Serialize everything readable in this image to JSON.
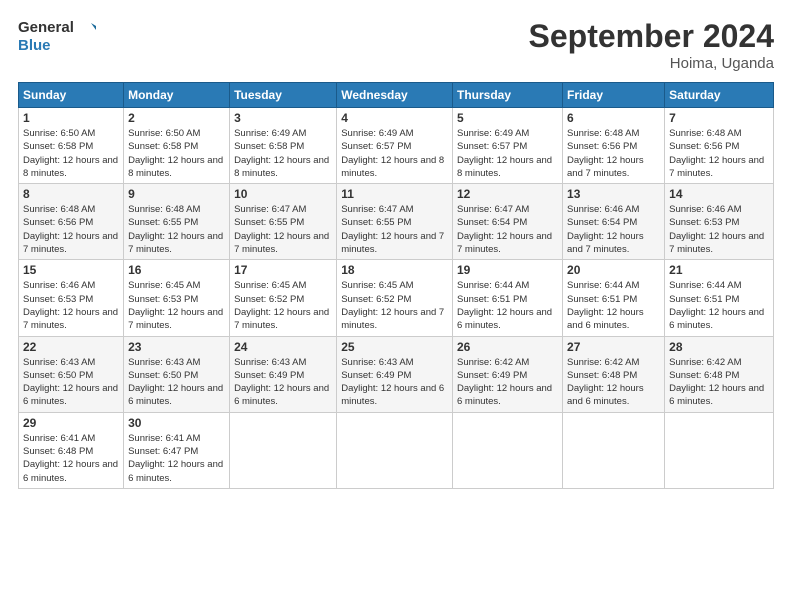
{
  "logo": {
    "line1": "General",
    "line2": "Blue"
  },
  "title": "September 2024",
  "subtitle": "Hoima, Uganda",
  "days_header": [
    "Sunday",
    "Monday",
    "Tuesday",
    "Wednesday",
    "Thursday",
    "Friday",
    "Saturday"
  ],
  "weeks": [
    [
      {
        "day": "1",
        "sunrise": "6:50 AM",
        "sunset": "6:58 PM",
        "daylight": "12 hours and 8 minutes."
      },
      {
        "day": "2",
        "sunrise": "6:50 AM",
        "sunset": "6:58 PM",
        "daylight": "12 hours and 8 minutes."
      },
      {
        "day": "3",
        "sunrise": "6:49 AM",
        "sunset": "6:58 PM",
        "daylight": "12 hours and 8 minutes."
      },
      {
        "day": "4",
        "sunrise": "6:49 AM",
        "sunset": "6:57 PM",
        "daylight": "12 hours and 8 minutes."
      },
      {
        "day": "5",
        "sunrise": "6:49 AM",
        "sunset": "6:57 PM",
        "daylight": "12 hours and 8 minutes."
      },
      {
        "day": "6",
        "sunrise": "6:48 AM",
        "sunset": "6:56 PM",
        "daylight": "12 hours and 7 minutes."
      },
      {
        "day": "7",
        "sunrise": "6:48 AM",
        "sunset": "6:56 PM",
        "daylight": "12 hours and 7 minutes."
      }
    ],
    [
      {
        "day": "8",
        "sunrise": "6:48 AM",
        "sunset": "6:56 PM",
        "daylight": "12 hours and 7 minutes."
      },
      {
        "day": "9",
        "sunrise": "6:48 AM",
        "sunset": "6:55 PM",
        "daylight": "12 hours and 7 minutes."
      },
      {
        "day": "10",
        "sunrise": "6:47 AM",
        "sunset": "6:55 PM",
        "daylight": "12 hours and 7 minutes."
      },
      {
        "day": "11",
        "sunrise": "6:47 AM",
        "sunset": "6:55 PM",
        "daylight": "12 hours and 7 minutes."
      },
      {
        "day": "12",
        "sunrise": "6:47 AM",
        "sunset": "6:54 PM",
        "daylight": "12 hours and 7 minutes."
      },
      {
        "day": "13",
        "sunrise": "6:46 AM",
        "sunset": "6:54 PM",
        "daylight": "12 hours and 7 minutes."
      },
      {
        "day": "14",
        "sunrise": "6:46 AM",
        "sunset": "6:53 PM",
        "daylight": "12 hours and 7 minutes."
      }
    ],
    [
      {
        "day": "15",
        "sunrise": "6:46 AM",
        "sunset": "6:53 PM",
        "daylight": "12 hours and 7 minutes."
      },
      {
        "day": "16",
        "sunrise": "6:45 AM",
        "sunset": "6:53 PM",
        "daylight": "12 hours and 7 minutes."
      },
      {
        "day": "17",
        "sunrise": "6:45 AM",
        "sunset": "6:52 PM",
        "daylight": "12 hours and 7 minutes."
      },
      {
        "day": "18",
        "sunrise": "6:45 AM",
        "sunset": "6:52 PM",
        "daylight": "12 hours and 7 minutes."
      },
      {
        "day": "19",
        "sunrise": "6:44 AM",
        "sunset": "6:51 PM",
        "daylight": "12 hours and 6 minutes."
      },
      {
        "day": "20",
        "sunrise": "6:44 AM",
        "sunset": "6:51 PM",
        "daylight": "12 hours and 6 minutes."
      },
      {
        "day": "21",
        "sunrise": "6:44 AM",
        "sunset": "6:51 PM",
        "daylight": "12 hours and 6 minutes."
      }
    ],
    [
      {
        "day": "22",
        "sunrise": "6:43 AM",
        "sunset": "6:50 PM",
        "daylight": "12 hours and 6 minutes."
      },
      {
        "day": "23",
        "sunrise": "6:43 AM",
        "sunset": "6:50 PM",
        "daylight": "12 hours and 6 minutes."
      },
      {
        "day": "24",
        "sunrise": "6:43 AM",
        "sunset": "6:49 PM",
        "daylight": "12 hours and 6 minutes."
      },
      {
        "day": "25",
        "sunrise": "6:43 AM",
        "sunset": "6:49 PM",
        "daylight": "12 hours and 6 minutes."
      },
      {
        "day": "26",
        "sunrise": "6:42 AM",
        "sunset": "6:49 PM",
        "daylight": "12 hours and 6 minutes."
      },
      {
        "day": "27",
        "sunrise": "6:42 AM",
        "sunset": "6:48 PM",
        "daylight": "12 hours and 6 minutes."
      },
      {
        "day": "28",
        "sunrise": "6:42 AM",
        "sunset": "6:48 PM",
        "daylight": "12 hours and 6 minutes."
      }
    ],
    [
      {
        "day": "29",
        "sunrise": "6:41 AM",
        "sunset": "6:48 PM",
        "daylight": "12 hours and 6 minutes."
      },
      {
        "day": "30",
        "sunrise": "6:41 AM",
        "sunset": "6:47 PM",
        "daylight": "12 hours and 6 minutes."
      },
      null,
      null,
      null,
      null,
      null
    ]
  ]
}
